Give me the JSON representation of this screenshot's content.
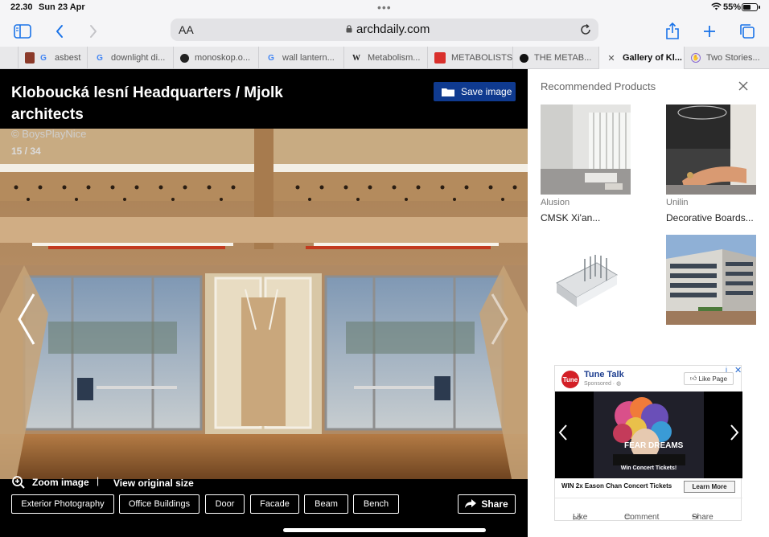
{
  "status": {
    "time": "22.30",
    "date": "Sun 23 Apr",
    "battery": "55%",
    "battery_level": 0.55
  },
  "toolbar": {
    "text_size": "AA",
    "domain": "archdaily.com"
  },
  "tabs": [
    {
      "label": "asbest",
      "fav": "",
      "fav2": "G"
    },
    {
      "label": "downlight di...",
      "fav": "G"
    },
    {
      "label": "monoskop.o...",
      "fav": ""
    },
    {
      "label": "wall lantern...",
      "fav": "G"
    },
    {
      "label": "Metabolism...",
      "fav": "W"
    },
    {
      "label": "METABOLISTS",
      "fav": ""
    },
    {
      "label": "THE METAB...",
      "fav": ""
    },
    {
      "label": "Gallery of Kl...",
      "fav": ""
    },
    {
      "label": "Two Stories...",
      "fav": ""
    }
  ],
  "gallery": {
    "title": "Kloboucká lesní Headquarters / Mjolk architects",
    "credit": "© BoysPlayNice",
    "counter": "15 / 34",
    "save_label": "Save image",
    "zoom_label": "Zoom image",
    "separator": "|",
    "original_label": "View original size",
    "tags": [
      "Exterior Photography",
      "Office Buildings",
      "Door",
      "Facade",
      "Beam",
      "Bench"
    ],
    "share_label": "Share"
  },
  "panel": {
    "title": "Recommended Products",
    "products": [
      {
        "brand": "Alusion",
        "name": "CMSK Xi'an..."
      },
      {
        "brand": "Unilin",
        "name": "Decorative Boards..."
      }
    ]
  },
  "ad": {
    "logo": "Tune",
    "name": "Tune Talk",
    "sponsored": "Sponsored · ",
    "like_page": "Like Page",
    "visual_title": "FEAR DREAMS",
    "caption": "Win Concert Tickets!",
    "headline": "WIN 2x Eason Chan Concert Tickets",
    "cta": "Learn More",
    "actions": [
      "Like",
      "Comment",
      "Share"
    ],
    "choice": "i",
    "close": "✕"
  }
}
